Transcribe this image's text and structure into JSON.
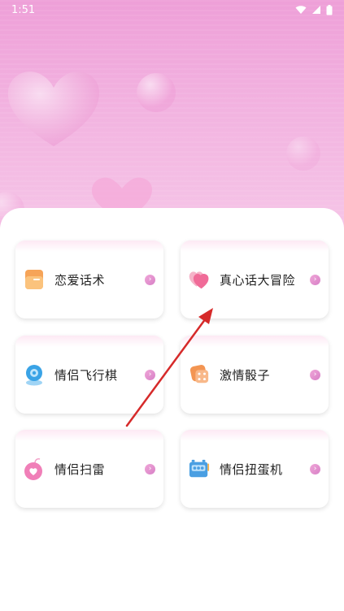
{
  "status_bar": {
    "time": "1:51",
    "icons": [
      "wifi-icon",
      "signal-icon",
      "battery-icon"
    ]
  },
  "games": [
    {
      "label": "恋爱话术",
      "icon": "chat-card-icon",
      "color": "#f5a25a"
    },
    {
      "label": "真心话大冒险",
      "icon": "hearts-icon",
      "color": "#f27ba3"
    },
    {
      "label": "情侣飞行棋",
      "icon": "plane-chess-icon",
      "color": "#4aaee8"
    },
    {
      "label": "激情骰子",
      "icon": "dice-icon",
      "color": "#f29a5a"
    },
    {
      "label": "情侣扫雷",
      "icon": "heart-bomb-icon",
      "color": "#f07fb8"
    },
    {
      "label": "情侣扭蛋机",
      "icon": "gacha-machine-icon",
      "color": "#4aa0e0"
    }
  ],
  "arrow_glyph": "›",
  "colors": {
    "header_gradient_top": "#ee9fd8",
    "header_gradient_bottom": "#f6c7e8",
    "accent": "#e08ad0",
    "annotation_arrow": "#d62a2a"
  }
}
